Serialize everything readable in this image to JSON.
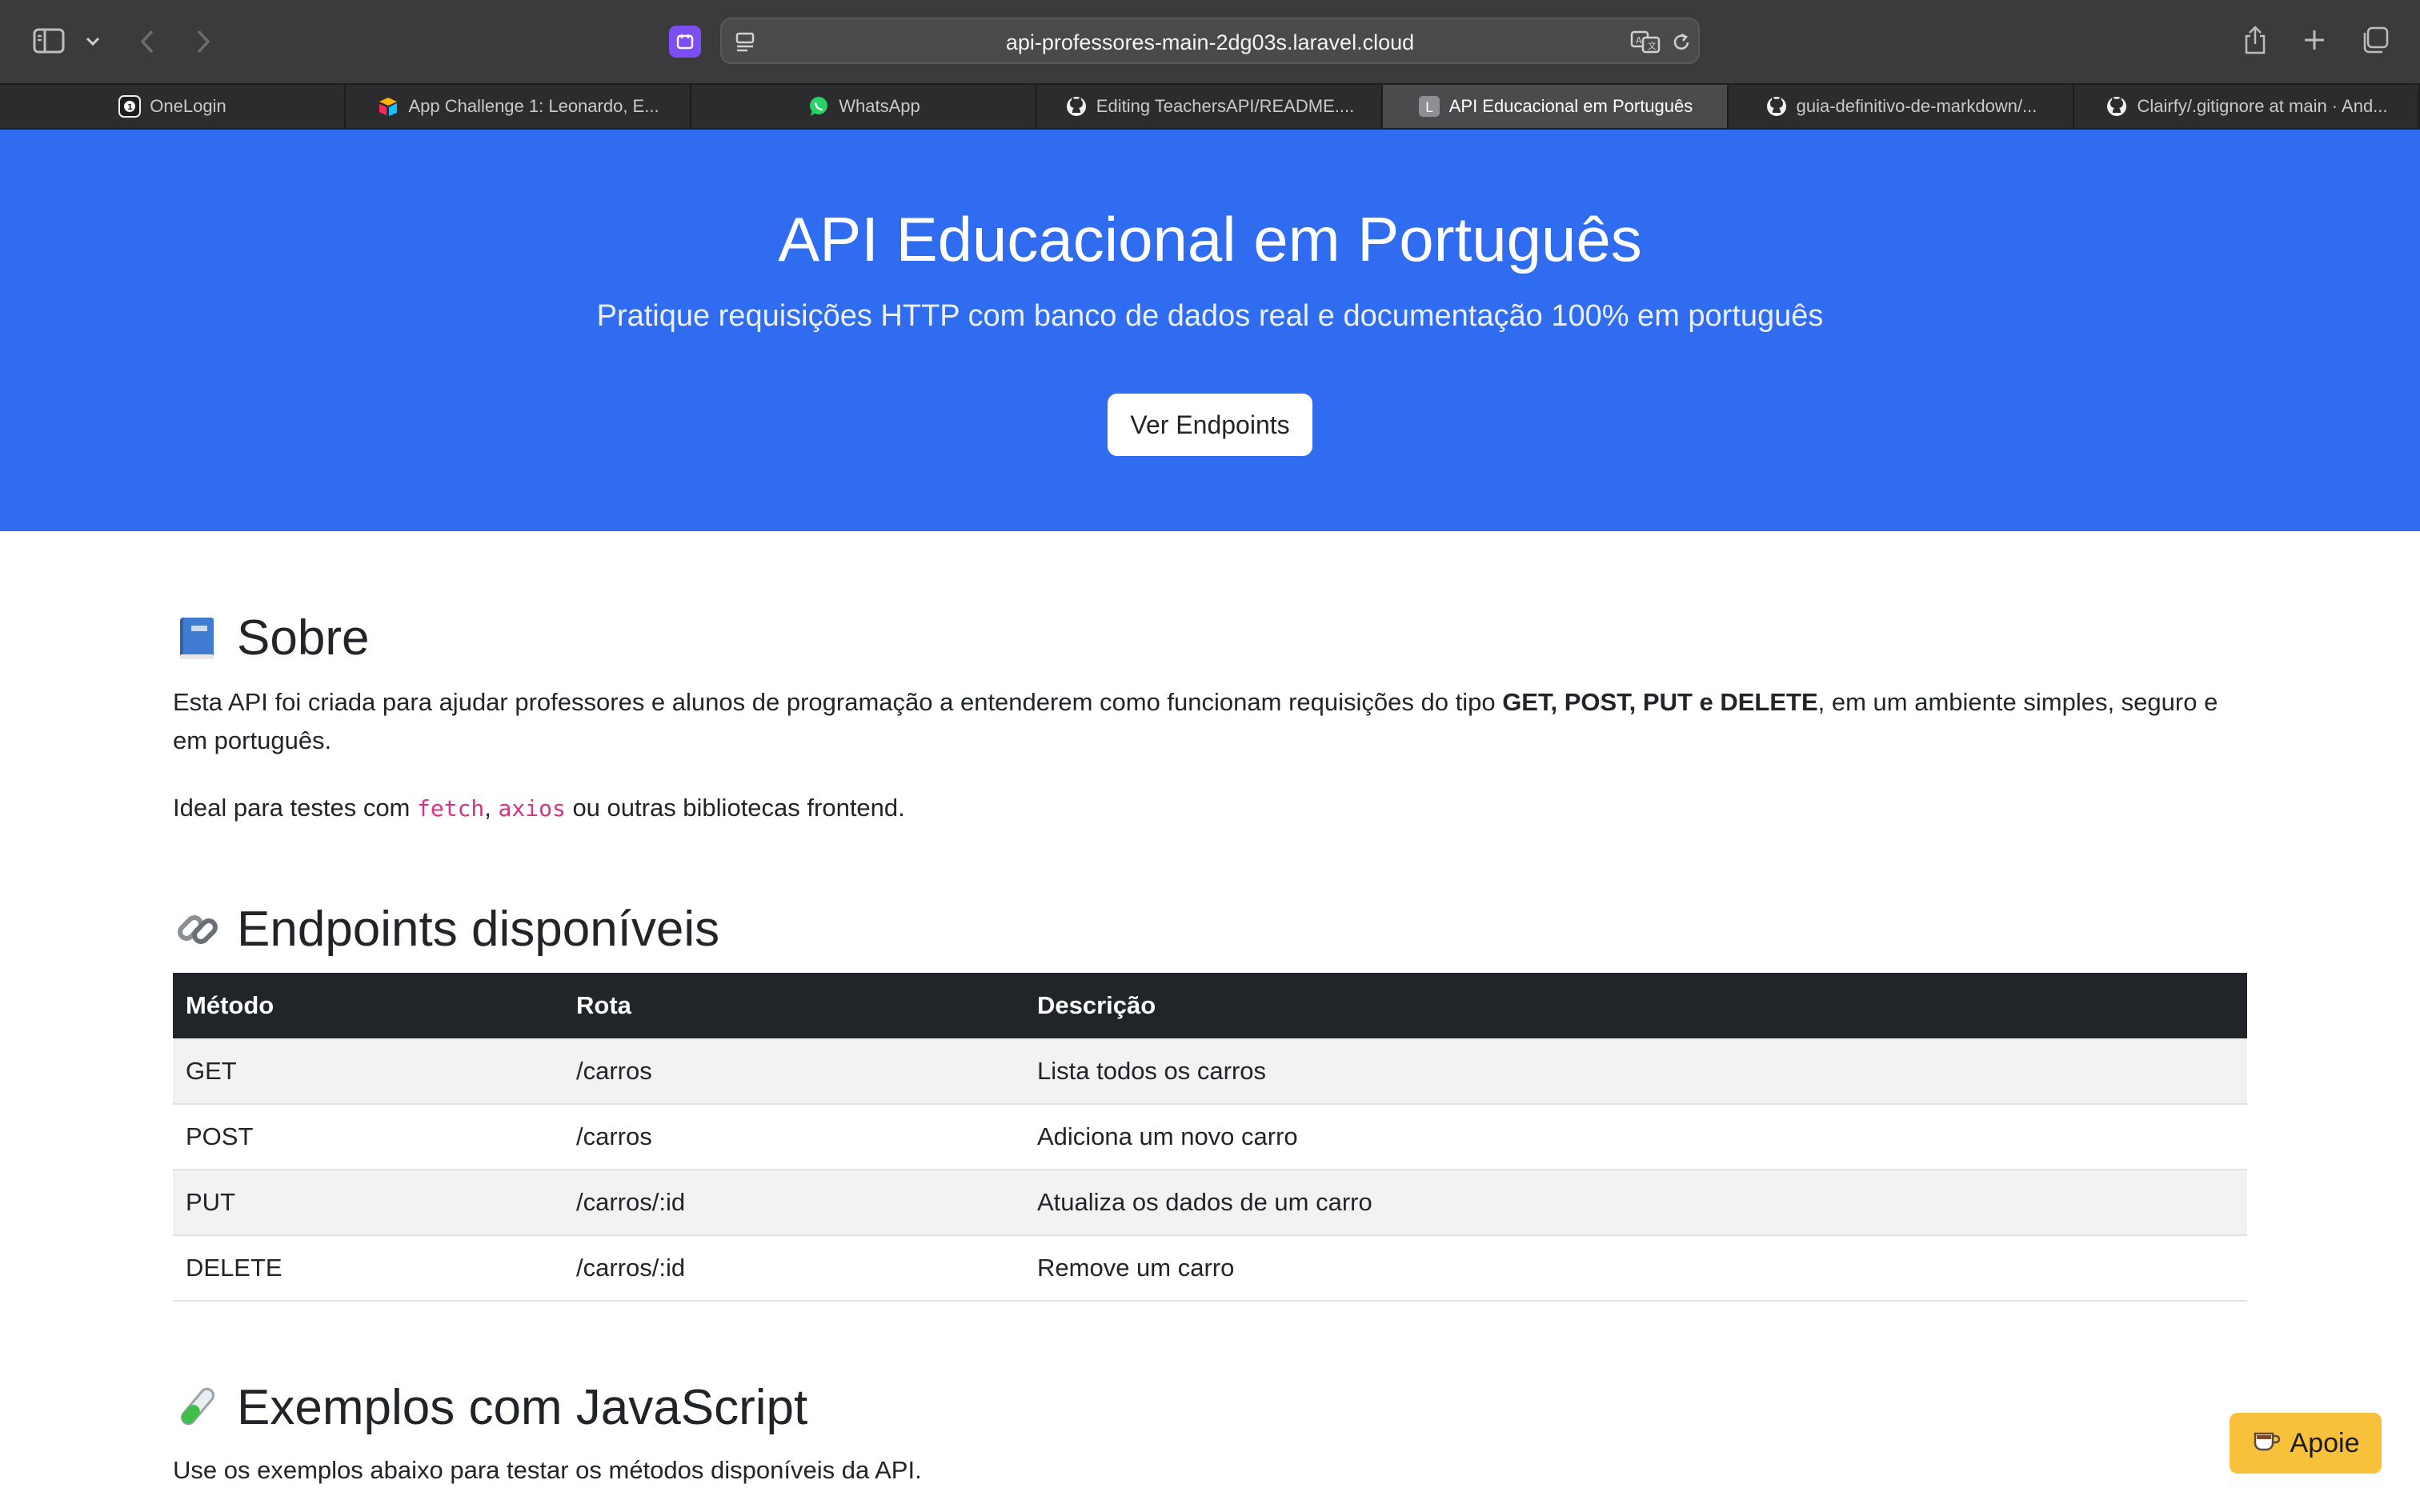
{
  "browser": {
    "url": "api-professores-main-2dg03s.laravel.cloud",
    "tabs": [
      {
        "label": "OneLogin",
        "icon": "onelogin-icon"
      },
      {
        "label": "App Challenge 1: Leonardo, E...",
        "icon": "airtable-icon"
      },
      {
        "label": "WhatsApp",
        "icon": "whatsapp-icon"
      },
      {
        "label": "Editing TeachersAPI/README....",
        "icon": "github-icon"
      },
      {
        "label": "API Educacional em Português",
        "icon": "letter-l-icon",
        "active": true
      },
      {
        "label": "guia-definitivo-de-markdown/...",
        "icon": "github-icon"
      },
      {
        "label": "Clairfy/.gitignore at main · And...",
        "icon": "github-icon"
      }
    ]
  },
  "hero": {
    "title": "API Educacional em Português",
    "subtitle": "Pratique requisições HTTP com banco de dados real e documentação 100% em português",
    "button": "Ver Endpoints",
    "bg_color": "#306cf0"
  },
  "sobre": {
    "title": "Sobre",
    "icon": "book-icon",
    "p1_before": "Esta API foi criada para ajudar professores e alunos de programação a entenderem como funcionam requisições do tipo ",
    "p1_bold": "GET, POST, PUT e DELETE",
    "p1_after": ", em um ambiente simples, seguro e em português.",
    "p2_before": "Ideal para testes com ",
    "p2_code1": "fetch",
    "p2_sep": ", ",
    "p2_code2": "axios",
    "p2_after": " ou outras bibliotecas frontend."
  },
  "endpoints": {
    "title": "Endpoints disponíveis",
    "icon": "link-icon",
    "headers": [
      "Método",
      "Rota",
      "Descrição"
    ],
    "rows": [
      [
        "GET",
        "/carros",
        "Lista todos os carros"
      ],
      [
        "POST",
        "/carros",
        "Adiciona um novo carro"
      ],
      [
        "PUT",
        "/carros/:id",
        "Atualiza os dados de um carro"
      ],
      [
        "DELETE",
        "/carros/:id",
        "Remove um carro"
      ]
    ]
  },
  "exemplos": {
    "title": "Exemplos com JavaScript",
    "icon": "test-tube-icon",
    "text": "Use os exemplos abaixo para testar os métodos disponíveis da API."
  },
  "apoie": {
    "label": "Apoie",
    "icon": "coffee-icon",
    "color": "#f7c13c"
  }
}
